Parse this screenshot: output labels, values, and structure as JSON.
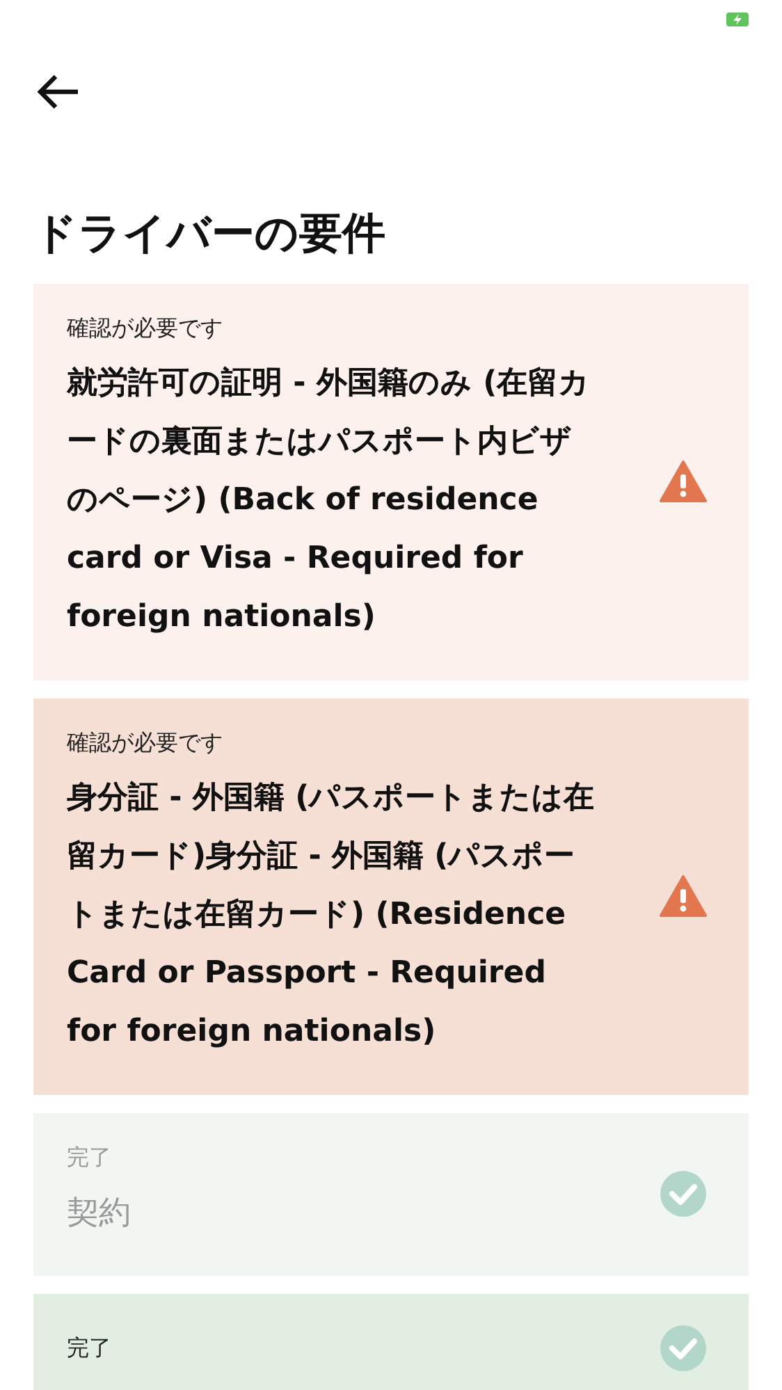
{
  "title": "ドライバーの要件",
  "requirements": [
    {
      "kind": "action_required",
      "highlighted": false,
      "disabled": false,
      "label": "確認が必要です",
      "name": "就労許可の証明 - 外国籍のみ (在留カードの裏面またはパスポート内ビザのページ) (Back of residence card or Visa - Required for foreign nationals)"
    },
    {
      "kind": "action_required",
      "highlighted": true,
      "disabled": false,
      "label": "確認が必要です",
      "name": "身分証 - 外国籍 (パスポートまたは在留カード)身分証 - 外国籍 (パスポートまたは在留カード) (Residence Card or Passport - Required for foreign nationals)"
    },
    {
      "kind": "done",
      "highlighted": false,
      "disabled": true,
      "label": "完了",
      "name": "契約"
    },
    {
      "kind": "done",
      "highlighted": true,
      "disabled": false,
      "label": "完了"
    }
  ]
}
